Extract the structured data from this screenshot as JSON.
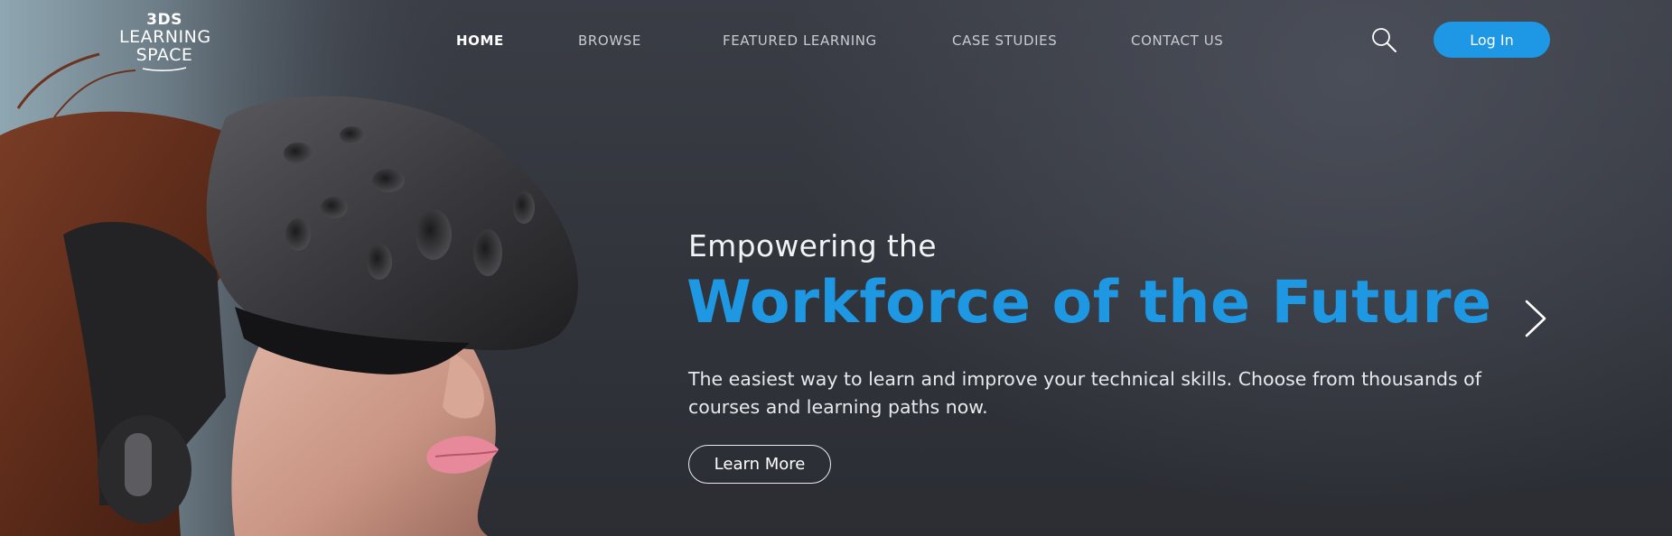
{
  "brand": {
    "logo_line1": "3DS",
    "logo_line2": "LEARNING",
    "logo_line3": "SPACE"
  },
  "nav": {
    "items": [
      {
        "label": "HOME",
        "active": true
      },
      {
        "label": "BROWSE",
        "active": false
      },
      {
        "label": "FEATURED LEARNING",
        "active": false
      },
      {
        "label": "CASE STUDIES",
        "active": false
      },
      {
        "label": "CONTACT US",
        "active": false
      }
    ],
    "search_icon": "search-icon",
    "login_label": "Log In"
  },
  "hero": {
    "eyebrow": "Empowering the",
    "headline": "Workforce of the Future",
    "subtext": "The easiest way to learn and improve your technical skills. Choose from thousands of courses and learning paths now.",
    "cta_label": "Learn More",
    "next_icon": "chevron-right-icon",
    "image": "person-wearing-vr-headset-photo"
  },
  "colors": {
    "accent": "#1e98e5",
    "background": "#30333a",
    "text": "#ffffff"
  }
}
